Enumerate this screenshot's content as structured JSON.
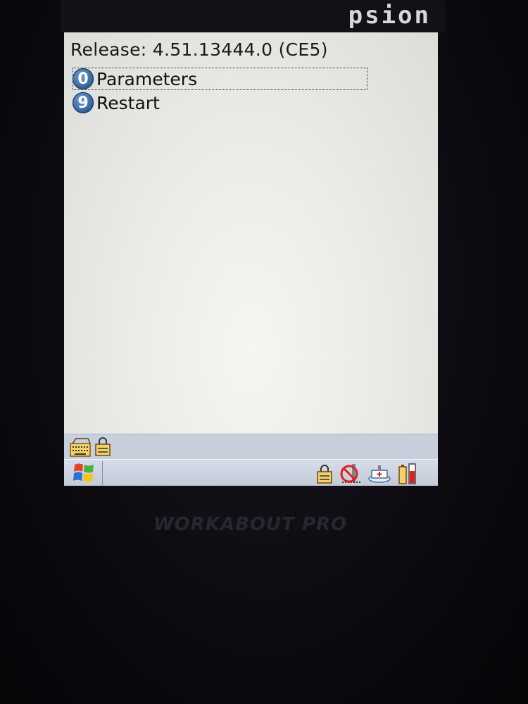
{
  "device": {
    "brand": "psion",
    "model_logo": "WORKABOUT PRO"
  },
  "screen": {
    "release_text": "Release: 4.51.13444.0 (CE5)",
    "menu": [
      {
        "key": "0",
        "label": "Parameters",
        "selected": true
      },
      {
        "key": "9",
        "label": "Restart",
        "selected": false
      }
    ]
  },
  "sip_bar": {
    "icons": [
      "keyboard-icon",
      "lock-icon"
    ]
  },
  "taskbar": {
    "start_icon": "windows-flag-icon",
    "tray_icons": [
      "lock-icon",
      "no-network-icon",
      "battery-charging-icon",
      "battery-level-icon"
    ]
  },
  "colors": {
    "screen_bg": "#ebebe8",
    "badge_blue": "#2e5f97",
    "taskbar": "#c7cfdc",
    "bezel": "#141018"
  }
}
